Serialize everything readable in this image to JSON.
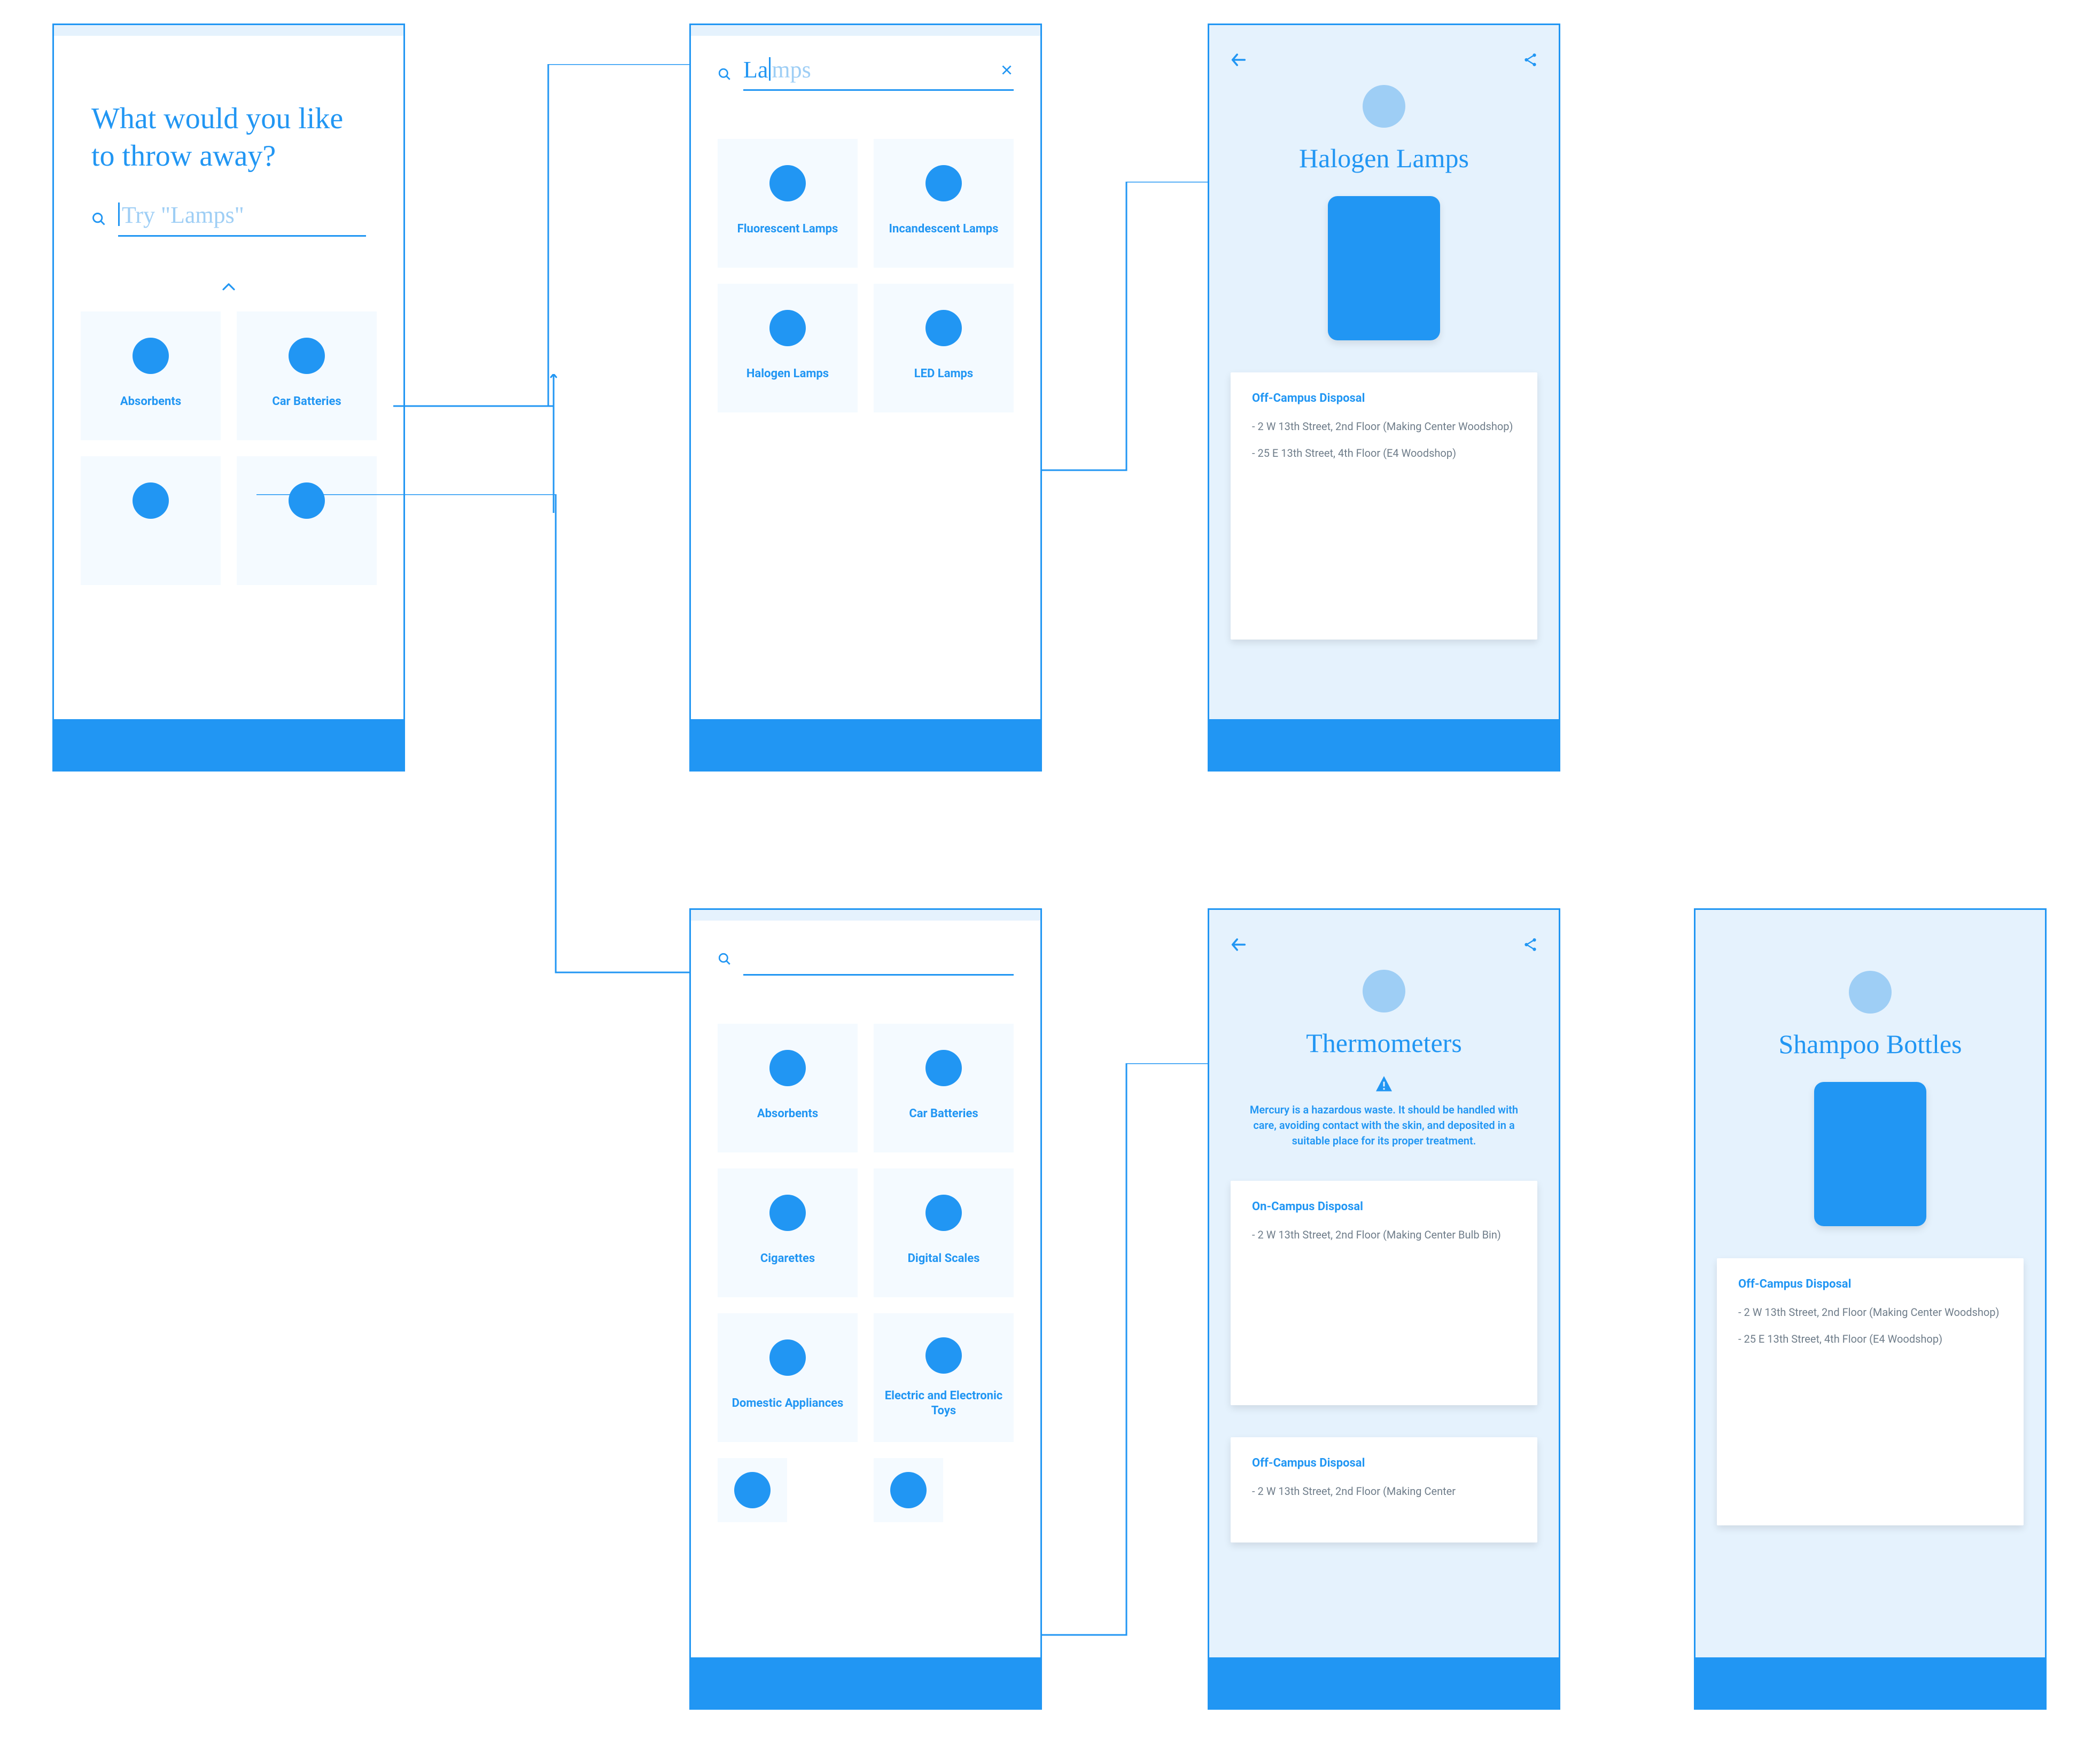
{
  "colors": {
    "primary": "#2196f3",
    "light": "#e5f2fd",
    "pale": "#9ecef5"
  },
  "home": {
    "title": "What would you like to throw away?",
    "search_placeholder": "Try \"Lamps\"",
    "categories": [
      "Absorbents",
      "Car Batteries"
    ]
  },
  "search_typed": {
    "typed": "La",
    "ghost": "mps",
    "results": [
      "Fluorescent Lamps",
      "Incandescent Lamps",
      "Halogen Lamps",
      "LED Lamps"
    ]
  },
  "search_all": {
    "results": [
      "Absorbents",
      "Car Batteries",
      "Cigarettes",
      "Digital Scales",
      "Domestic Appliances",
      "Electric and Electronic Toys"
    ]
  },
  "detail_halogen": {
    "title": "Halogen Lamps",
    "card": {
      "title": "Off-Campus Disposal",
      "lines": [
        "- 2 W 13th Street, 2nd Floor (Making Center Woodshop)",
        "- 25 E 13th Street, 4th Floor (E4 Woodshop)"
      ]
    }
  },
  "detail_thermometers": {
    "title": "Thermometers",
    "warning": "Mercury is a hazardous waste. It should be handled with care, avoiding contact with the skin, and deposited in a suitable place for its proper treatment.",
    "card1": {
      "title": "On-Campus Disposal",
      "lines": [
        "- 2 W 13th Street, 2nd Floor (Making Center Bulb Bin)"
      ]
    },
    "card2": {
      "title": "Off-Campus Disposal",
      "lines": [
        "- 2 W 13th Street, 2nd Floor (Making Center"
      ]
    }
  },
  "detail_shampoo": {
    "title": "Shampoo Bottles",
    "card": {
      "title": "Off-Campus Disposal",
      "lines": [
        "- 2 W 13th Street, 2nd Floor (Making Center Woodshop)",
        "- 25 E 13th Street, 4th Floor (E4 Woodshop)"
      ]
    }
  }
}
